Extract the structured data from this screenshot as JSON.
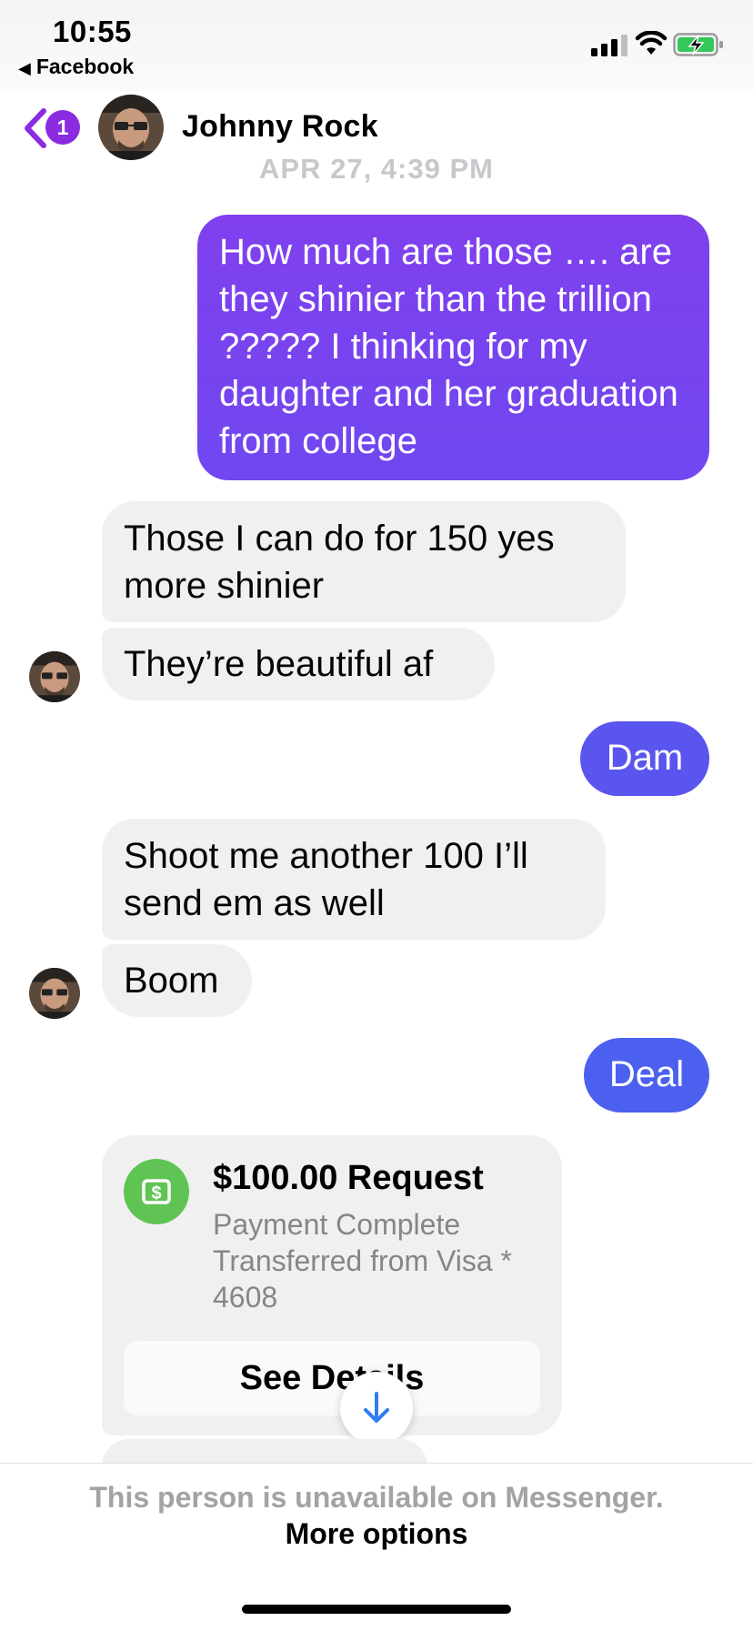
{
  "status_bar": {
    "time": "10:55",
    "back_app_label": "Facebook"
  },
  "header": {
    "unread_count": "1",
    "contact_name": "Johnny Rock"
  },
  "thread": {
    "timestamp": "APR 27, 4:39 PM",
    "messages": [
      {
        "direction": "outgoing",
        "text": "How much are those …. are they shinier than the trillion ????? I thinking for my daughter and her graduation from college"
      },
      {
        "direction": "incoming",
        "text": "Those I can do for 150 yes more shinier"
      },
      {
        "direction": "incoming",
        "text": "They’re beautiful af"
      },
      {
        "direction": "outgoing",
        "text": "Dam"
      },
      {
        "direction": "incoming",
        "text": "Shoot me another 100 I’ll send em as well"
      },
      {
        "direction": "incoming",
        "text": "Boom"
      },
      {
        "direction": "outgoing",
        "text": "Deal"
      }
    ],
    "payment": {
      "title": "$100.00 Request",
      "status": "Payment Complete",
      "source": "Transferred from Visa * 4608",
      "button_label": "See Details"
    }
  },
  "footer": {
    "unavailable_text": "This person is unavailable on Messenger.",
    "more_options_label": "More options"
  },
  "colors": {
    "outgoing_purple": "#7a44ef",
    "outgoing_blue": "#4c60ef",
    "incoming_gray": "#f0f0f0",
    "badge": "#8a2be2",
    "payment_green": "#5fc454"
  }
}
